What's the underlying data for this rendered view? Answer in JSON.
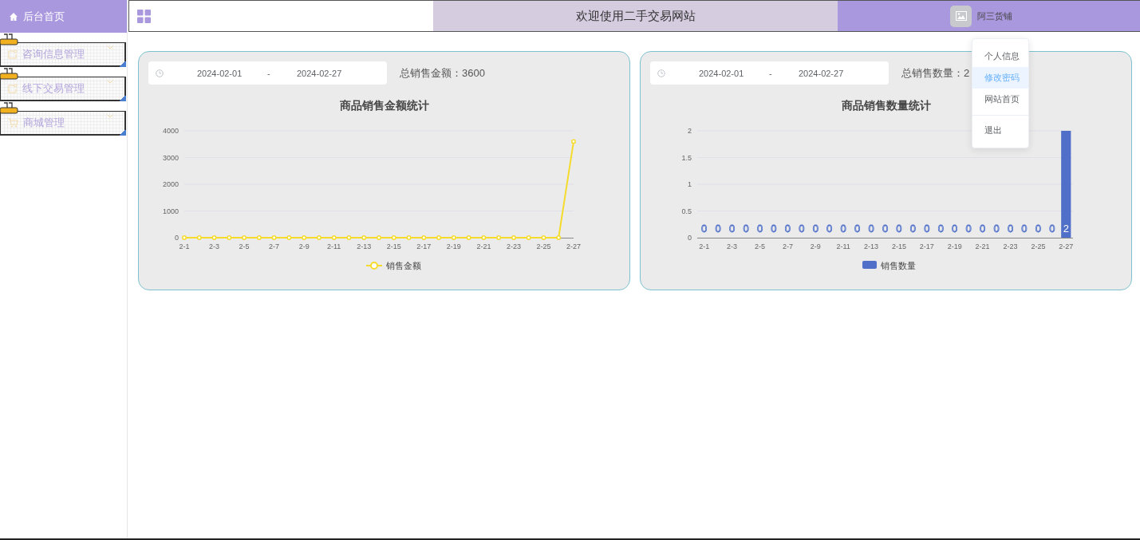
{
  "sidebar": {
    "home": {
      "label": "后台首页",
      "selected": true
    },
    "items": [
      {
        "label": "咨询信息管理",
        "kind": "document"
      },
      {
        "label": "线下交易管理",
        "kind": "document"
      },
      {
        "label": "商城管理",
        "kind": "cart"
      }
    ]
  },
  "header": {
    "title": "欢迎使用二手交易网站",
    "user": "阿三货铺"
  },
  "user_menu": [
    {
      "label": "个人信息",
      "selected": false,
      "separated": false
    },
    {
      "label": "修改密码",
      "selected": true,
      "separated": false
    },
    {
      "label": "网站首页",
      "selected": false,
      "separated": false
    },
    {
      "label": "退出",
      "selected": false,
      "separated": true
    }
  ],
  "panels": [
    {
      "date_start": "2024-02-01",
      "date_sep": "-",
      "date_end": "2024-02-27",
      "summary": "总销售金额：3600",
      "chart_data": {
        "type": "line",
        "title": "商品销售金额统计",
        "grid": true,
        "categories": [
          "2-1",
          null,
          "2-3",
          null,
          "2-5",
          null,
          "2-7",
          null,
          "2-9",
          null,
          "2-11",
          null,
          "2-13",
          null,
          "2-15",
          null,
          "2-17",
          null,
          "2-19",
          null,
          "2-21",
          null,
          "2-23",
          null,
          "2-25",
          null,
          "2-27"
        ],
        "series": [
          {
            "name": "销售金额",
            "color": "#f5dc2c",
            "marker": true,
            "values": [
              0,
              0,
              0,
              0,
              0,
              0,
              0,
              0,
              0,
              0,
              0,
              0,
              0,
              0,
              0,
              0,
              0,
              0,
              0,
              0,
              0,
              0,
              0,
              0,
              0,
              0,
              3600
            ]
          }
        ],
        "ylim": [
          0,
          4000
        ],
        "yticks": [
          0,
          1000,
          2000,
          3000,
          4000
        ]
      }
    },
    {
      "date_start": "2024-02-01",
      "date_sep": "-",
      "date_end": "2024-02-27",
      "summary": "总销售数量：2",
      "chart_data": {
        "type": "bar",
        "title": "商品销售数量统计",
        "grid": true,
        "categories": [
          "2-1",
          null,
          "2-3",
          null,
          "2-5",
          null,
          "2-7",
          null,
          "2-9",
          null,
          "2-11",
          null,
          "2-13",
          null,
          "2-15",
          null,
          "2-17",
          null,
          "2-19",
          null,
          "2-21",
          null,
          "2-23",
          null,
          "2-25",
          null,
          "2-27"
        ],
        "series": [
          {
            "name": "销售数量",
            "color": "#4f6fc8",
            "values": [
              0,
              0,
              0,
              0,
              0,
              0,
              0,
              0,
              0,
              0,
              0,
              0,
              0,
              0,
              0,
              0,
              0,
              0,
              0,
              0,
              0,
              0,
              0,
              0,
              0,
              0,
              2
            ]
          }
        ],
        "ylim": [
          0,
          2
        ],
        "yticks": [
          0,
          0.5,
          1,
          1.5,
          2
        ],
        "data_labels": true
      }
    }
  ]
}
